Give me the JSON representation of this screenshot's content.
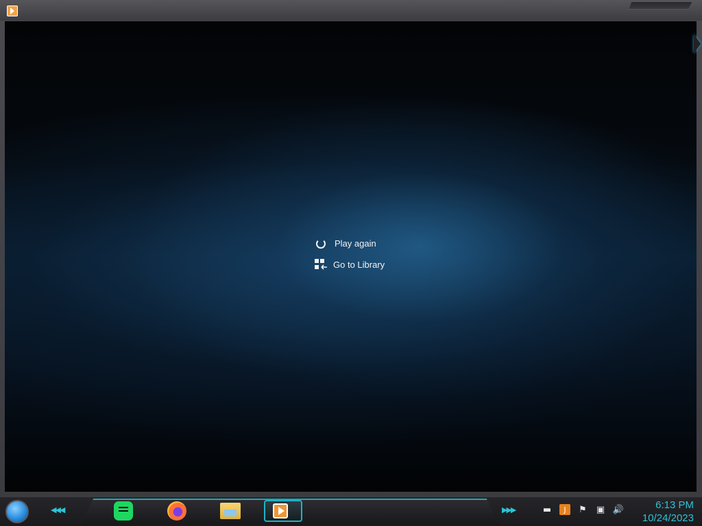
{
  "window": {
    "icon": "media-player-icon"
  },
  "end_screen": {
    "play_again_label": "Play again",
    "play_again_icon": "replay-icon",
    "go_to_library_label": "Go to Library",
    "go_to_library_icon": "library-icon"
  },
  "taskbar": {
    "start_icon": "start-orb-icon",
    "pinned": [
      {
        "name": "spotify-icon"
      },
      {
        "name": "firefox-icon"
      },
      {
        "name": "file-explorer-icon"
      },
      {
        "name": "media-player-icon",
        "active": true
      }
    ],
    "tray_icons": [
      "show-hidden-icons",
      "java-icon",
      "action-center-flag-icon",
      "network-icon",
      "volume-icon"
    ],
    "clock_time": "6:13 PM",
    "clock_date": "10/24/2023"
  },
  "colors": {
    "accent": "#2ec3d6",
    "background_blue": "#0a1f33"
  }
}
